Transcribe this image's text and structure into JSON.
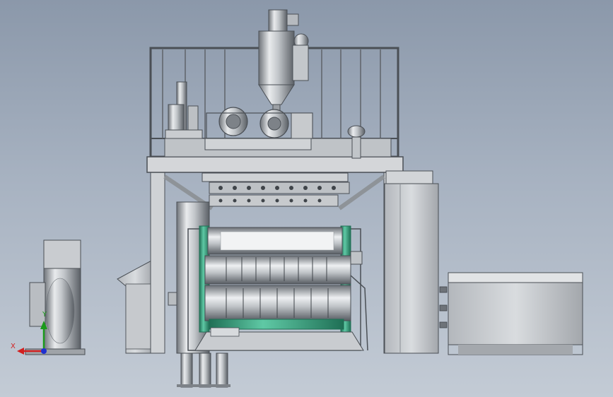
{
  "viewport": {
    "background_top": "#8b98aa",
    "background_bottom": "#c3cbd5"
  },
  "model": {
    "metal_dark": "#5a5f66",
    "metal_mid": "#a9adb2",
    "metal_light": "#e6e8ea",
    "frame_color": "#d4d6d9",
    "accent_green": "#2f9e7a",
    "accent_dark_green": "#1f6f55"
  },
  "triad": {
    "x_label": "X",
    "y_label": "Y",
    "x_color": "#d22020",
    "y_color": "#1a9a1a",
    "z_color": "#2030d0"
  }
}
